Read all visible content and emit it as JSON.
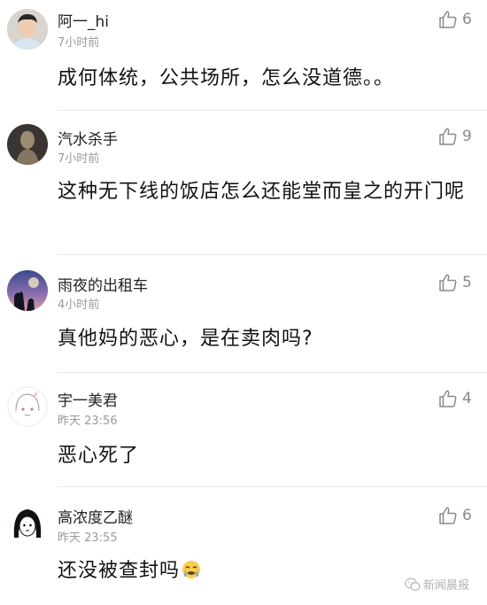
{
  "comments": [
    {
      "username": "阿一_hi",
      "time": "7小时前",
      "likes": "6",
      "text": "成何体统，公共场所，怎么没道德。。",
      "avatar_icon": "young-man-portrait-avatar"
    },
    {
      "username": "汽水杀手",
      "time": "7小时前",
      "likes": "9",
      "text": "这种无下线的饭店怎么还能堂而皇之的开门呢",
      "avatar_icon": "terracotta-warrior-avatar"
    },
    {
      "username": "雨夜的出租车",
      "time": "4小时前",
      "likes": "5",
      "text": "真他妈的恶心，是在卖肉吗?",
      "avatar_icon": "night-silhouette-avatar"
    },
    {
      "username": "宇一美君",
      "time": "昨天 23:56",
      "likes": "4",
      "text": "恶心死了",
      "avatar_icon": "anime-girl-sketch-avatar"
    },
    {
      "username": "高浓度乙醚",
      "time": "昨天 23:55",
      "likes": "6",
      "text": "还没被查封吗",
      "avatar_icon": "black-hair-cartoon-avatar",
      "trailing_emoji": "crying-face-emoji"
    }
  ],
  "watermark": {
    "text": "新闻晨报",
    "icon": "wechat-icon"
  },
  "colors": {
    "username": "#222222",
    "time": "#9a9a9a",
    "like": "#8a8a8a",
    "divider": "#e9e9e9"
  }
}
